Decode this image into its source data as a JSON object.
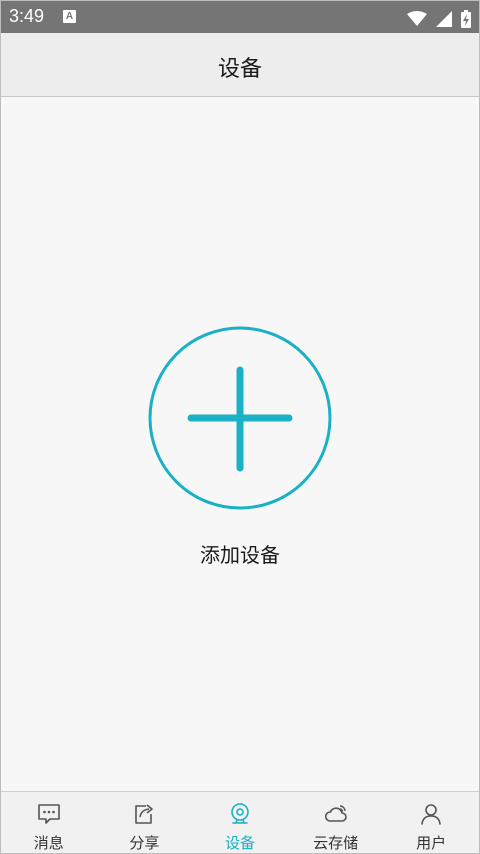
{
  "status_bar": {
    "time": "3:49",
    "notification_badge": "A",
    "icons": [
      "wifi-icon",
      "signal-icon",
      "battery-charging-icon"
    ]
  },
  "header": {
    "title": "设备"
  },
  "main": {
    "add_button_icon": "plus-circle-icon",
    "add_label": "添加设备"
  },
  "tabs": [
    {
      "label": "消息",
      "icon": "message-icon",
      "active": false
    },
    {
      "label": "分享",
      "icon": "share-icon",
      "active": false
    },
    {
      "label": "设备",
      "icon": "camera-icon",
      "active": true
    },
    {
      "label": "云存储",
      "icon": "cloud-icon",
      "active": false
    },
    {
      "label": "用户",
      "icon": "user-icon",
      "active": false
    }
  ],
  "colors": {
    "accent": "#1ab0c6",
    "status_bar": "#757575",
    "header_bg": "#ededed",
    "page_bg": "#f7f7f7",
    "tab_bar_bg": "#f1f1f1",
    "inactive_icon": "#555555"
  }
}
